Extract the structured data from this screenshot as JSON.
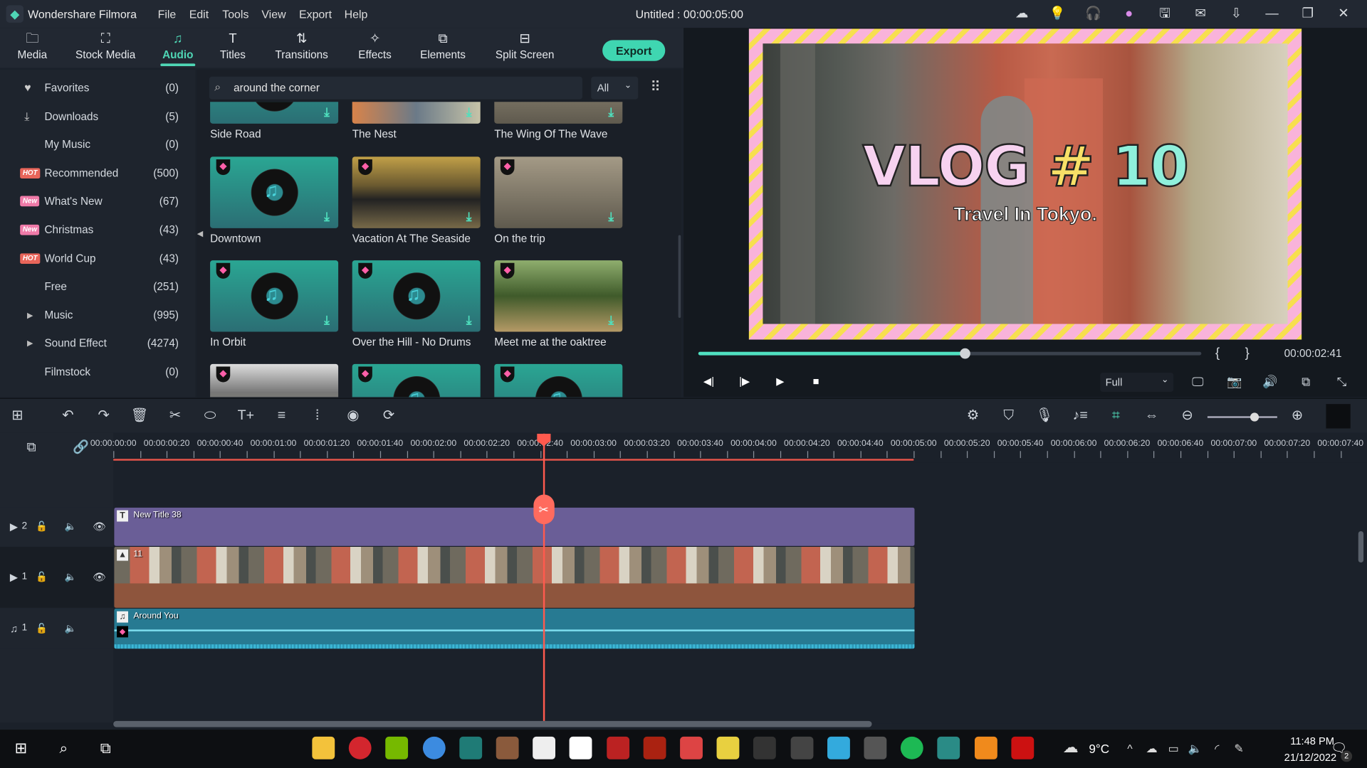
{
  "app": {
    "name": "Wondershare Filmora",
    "project_title": "Untitled : 00:00:05:00",
    "menu": [
      "File",
      "Edit",
      "Tools",
      "View",
      "Export",
      "Help"
    ]
  },
  "titlebar_icons": [
    "cloud-icon",
    "lightbulb-icon",
    "headset-icon",
    "avatar-icon",
    "save-icon",
    "mail-icon",
    "download-icon",
    "minimize-icon",
    "restore-icon",
    "close-icon"
  ],
  "nav": {
    "tabs": [
      {
        "label": "Media",
        "icon": "folder-icon"
      },
      {
        "label": "Stock Media",
        "icon": "stock-media-icon"
      },
      {
        "label": "Audio",
        "icon": "music-note-icon",
        "active": true
      },
      {
        "label": "Titles",
        "icon": "text-icon"
      },
      {
        "label": "Transitions",
        "icon": "transitions-icon"
      },
      {
        "label": "Effects",
        "icon": "effects-icon"
      },
      {
        "label": "Elements",
        "icon": "elements-icon"
      },
      {
        "label": "Split Screen",
        "icon": "split-screen-icon"
      }
    ],
    "export_label": "Export"
  },
  "sidebar": {
    "items": [
      {
        "label": "Favorites",
        "count": "(0)",
        "icon": "heart-icon"
      },
      {
        "label": "Downloads",
        "count": "(5)",
        "icon": "download-icon"
      },
      {
        "label": "My Music",
        "count": "(0)"
      },
      {
        "label": "Recommended",
        "count": "(500)",
        "badge": "HOT"
      },
      {
        "label": "What's New",
        "count": "(67)",
        "badge": "New"
      },
      {
        "label": "Christmas",
        "count": "(43)",
        "badge": "New"
      },
      {
        "label": "World Cup",
        "count": "(43)",
        "badge": "HOT"
      },
      {
        "label": "Free",
        "count": "(251)"
      },
      {
        "label": "Music",
        "count": "(995)",
        "expand": true
      },
      {
        "label": "Sound Effect",
        "count": "(4274)",
        "expand": true
      },
      {
        "label": "Filmstock",
        "count": "(0)"
      }
    ]
  },
  "search": {
    "value": "around the corner",
    "filter": "All"
  },
  "library": {
    "items": [
      {
        "title": "Side Road",
        "type": "music"
      },
      {
        "title": "The Nest",
        "type": "photo"
      },
      {
        "title": "The Wing Of The Wave",
        "type": "photo"
      },
      {
        "title": "Downtown",
        "type": "music"
      },
      {
        "title": "Vacation At The Seaside",
        "type": "photo"
      },
      {
        "title": "On the trip",
        "type": "photo"
      },
      {
        "title": "In Orbit",
        "type": "music"
      },
      {
        "title": "Over the Hill - No Drums",
        "type": "music"
      },
      {
        "title": "Meet me at the oaktree",
        "type": "photo"
      },
      {
        "title": "",
        "type": "photo"
      },
      {
        "title": "",
        "type": "music"
      },
      {
        "title": "",
        "type": "music"
      }
    ]
  },
  "preview": {
    "title_main": "VLOG",
    "title_hash": "#",
    "title_num": "10",
    "subtitle": "Travel In Tokyo.",
    "progress_percent": 53,
    "timecode": "00:00:02:41",
    "quality": "Full",
    "mark_in": "{",
    "mark_out": "}"
  },
  "timeline": {
    "ruler": [
      "00:00:00:00",
      "00:00:00:20",
      "00:00:00:40",
      "00:00:01:00",
      "00:00:01:20",
      "00:00:01:40",
      "00:00:02:00",
      "00:00:02:20",
      "00:00:02:40",
      "00:00:03:00",
      "00:00:03:20",
      "00:00:03:40",
      "00:00:04:00",
      "00:00:04:20",
      "00:00:04:40",
      "00:00:05:00",
      "00:00:05:20",
      "00:00:05:40",
      "00:00:06:00",
      "00:00:06:20",
      "00:00:06:40",
      "00:00:07:00",
      "00:00:07:20",
      "00:00:07:40"
    ],
    "playhead": "00:00:02:41",
    "tracks": [
      {
        "label": "2",
        "kind": "video",
        "clip": "New Title 38",
        "color": "#6a5e97"
      },
      {
        "label": "1",
        "kind": "video",
        "clip": "11",
        "color": "#8e553d"
      },
      {
        "label": "1",
        "kind": "audio",
        "clip": "Around You",
        "color": "#277a92"
      }
    ],
    "clip_end": "00:00:05:00",
    "zoom_level": 0.68
  },
  "taskbar": {
    "weather": "9°C",
    "time": "11:48 PM",
    "date": "21/12/2022",
    "notifications": "2"
  }
}
